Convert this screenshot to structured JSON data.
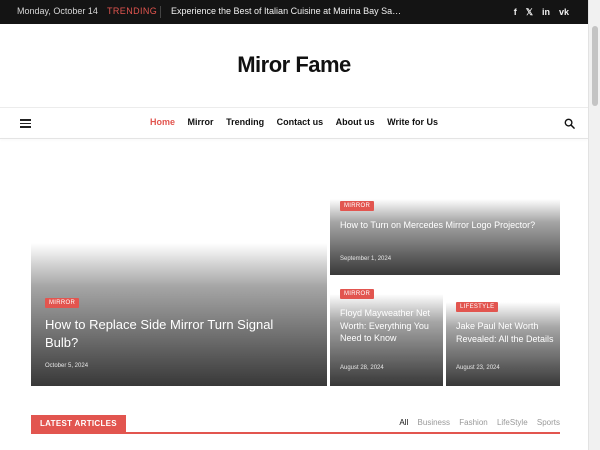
{
  "topbar": {
    "date": "Monday, October 14",
    "trending_label": "TRENDING",
    "headline": "Experience the Best of Italian Cuisine at Marina Bay Sands: ...",
    "social_icons": [
      "facebook-icon",
      "x-icon",
      "linkedin-icon",
      "vk-icon"
    ],
    "social_glyphs": [
      "f",
      "𝕏",
      "in",
      "vk"
    ]
  },
  "site": {
    "logo": "Miror Fame"
  },
  "nav": {
    "items": [
      "Home",
      "Mirror",
      "Trending",
      "Contact us",
      "About us",
      "Write for Us"
    ],
    "active_index": 0
  },
  "features": [
    {
      "category": "MIRROR",
      "title": "How to Replace Side Mirror Turn Signal Bulb?",
      "date": "October 5, 2024"
    },
    {
      "category": "MIRROR",
      "title": "How to Turn on Mercedes Mirror Logo Projector?",
      "date": "September 1, 2024"
    },
    {
      "category": "MIRROR",
      "title": "Floyd Mayweather Net Worth: Everything You Need to Know",
      "date": "August 28, 2024"
    },
    {
      "category": "LIFESTYLE",
      "title": "Jake Paul Net Worth Revealed: All the Details",
      "date": "August 23, 2024"
    }
  ],
  "latest": {
    "label": "LATEST ARTICLES",
    "filters": [
      "All",
      "Business",
      "Fashion",
      "LifeStyle",
      "Sports"
    ],
    "active_filter": 0
  },
  "colors": {
    "accent": "#e2554f",
    "topbar_bg": "#141414"
  }
}
